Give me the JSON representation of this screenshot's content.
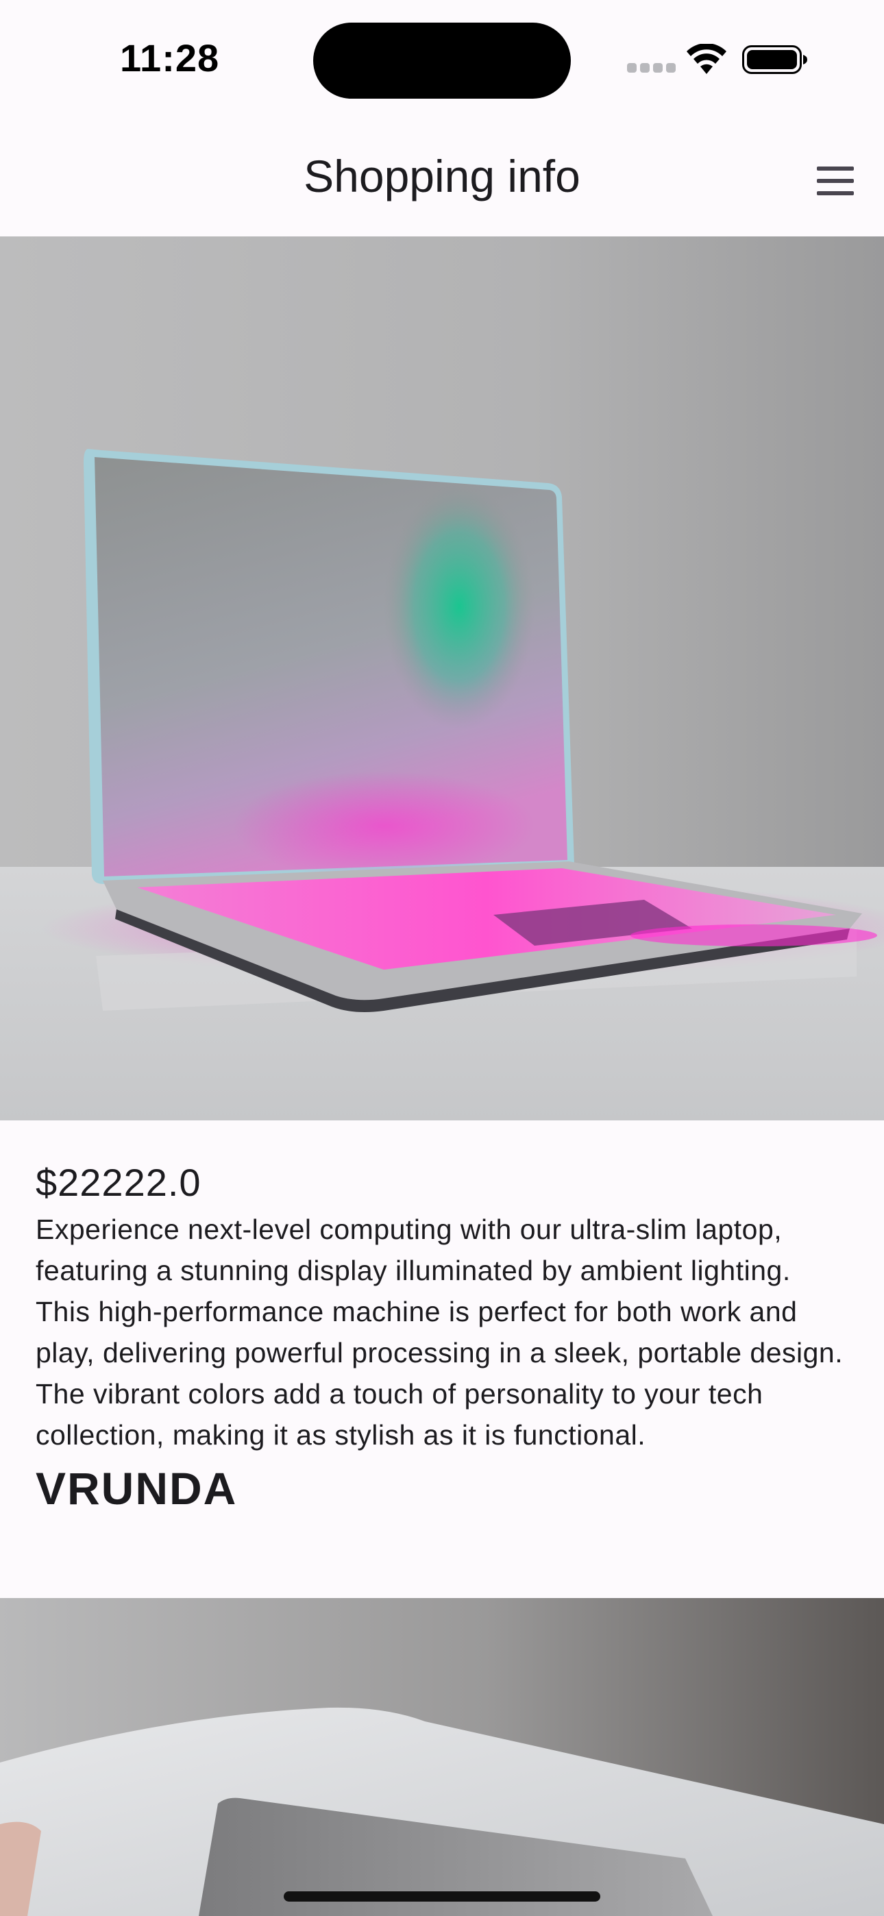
{
  "status_bar": {
    "time": "11:28"
  },
  "app_bar": {
    "title": "Shopping info",
    "menu_icon": "hamburger-menu-icon"
  },
  "products": [
    {
      "image_description_icon": "laptop-product-image",
      "price": "$22222.0",
      "description": "Experience next-level computing with our ultra-slim laptop, featuring a stunning display illuminated by ambient lighting. This high-performance machine is perfect for both work and play, delivering powerful processing in a sleek, portable design. The vibrant colors add a touch of personality to your tech collection, making it as stylish as it is functional.",
      "brand": "VRUNDA"
    },
    {
      "image_description_icon": "laptop-product-image"
    }
  ],
  "colors": {
    "background": "#fdfafd",
    "text": "#1c1b1f",
    "accent_pink": "#ff2bd0",
    "accent_green": "#14c78f"
  }
}
